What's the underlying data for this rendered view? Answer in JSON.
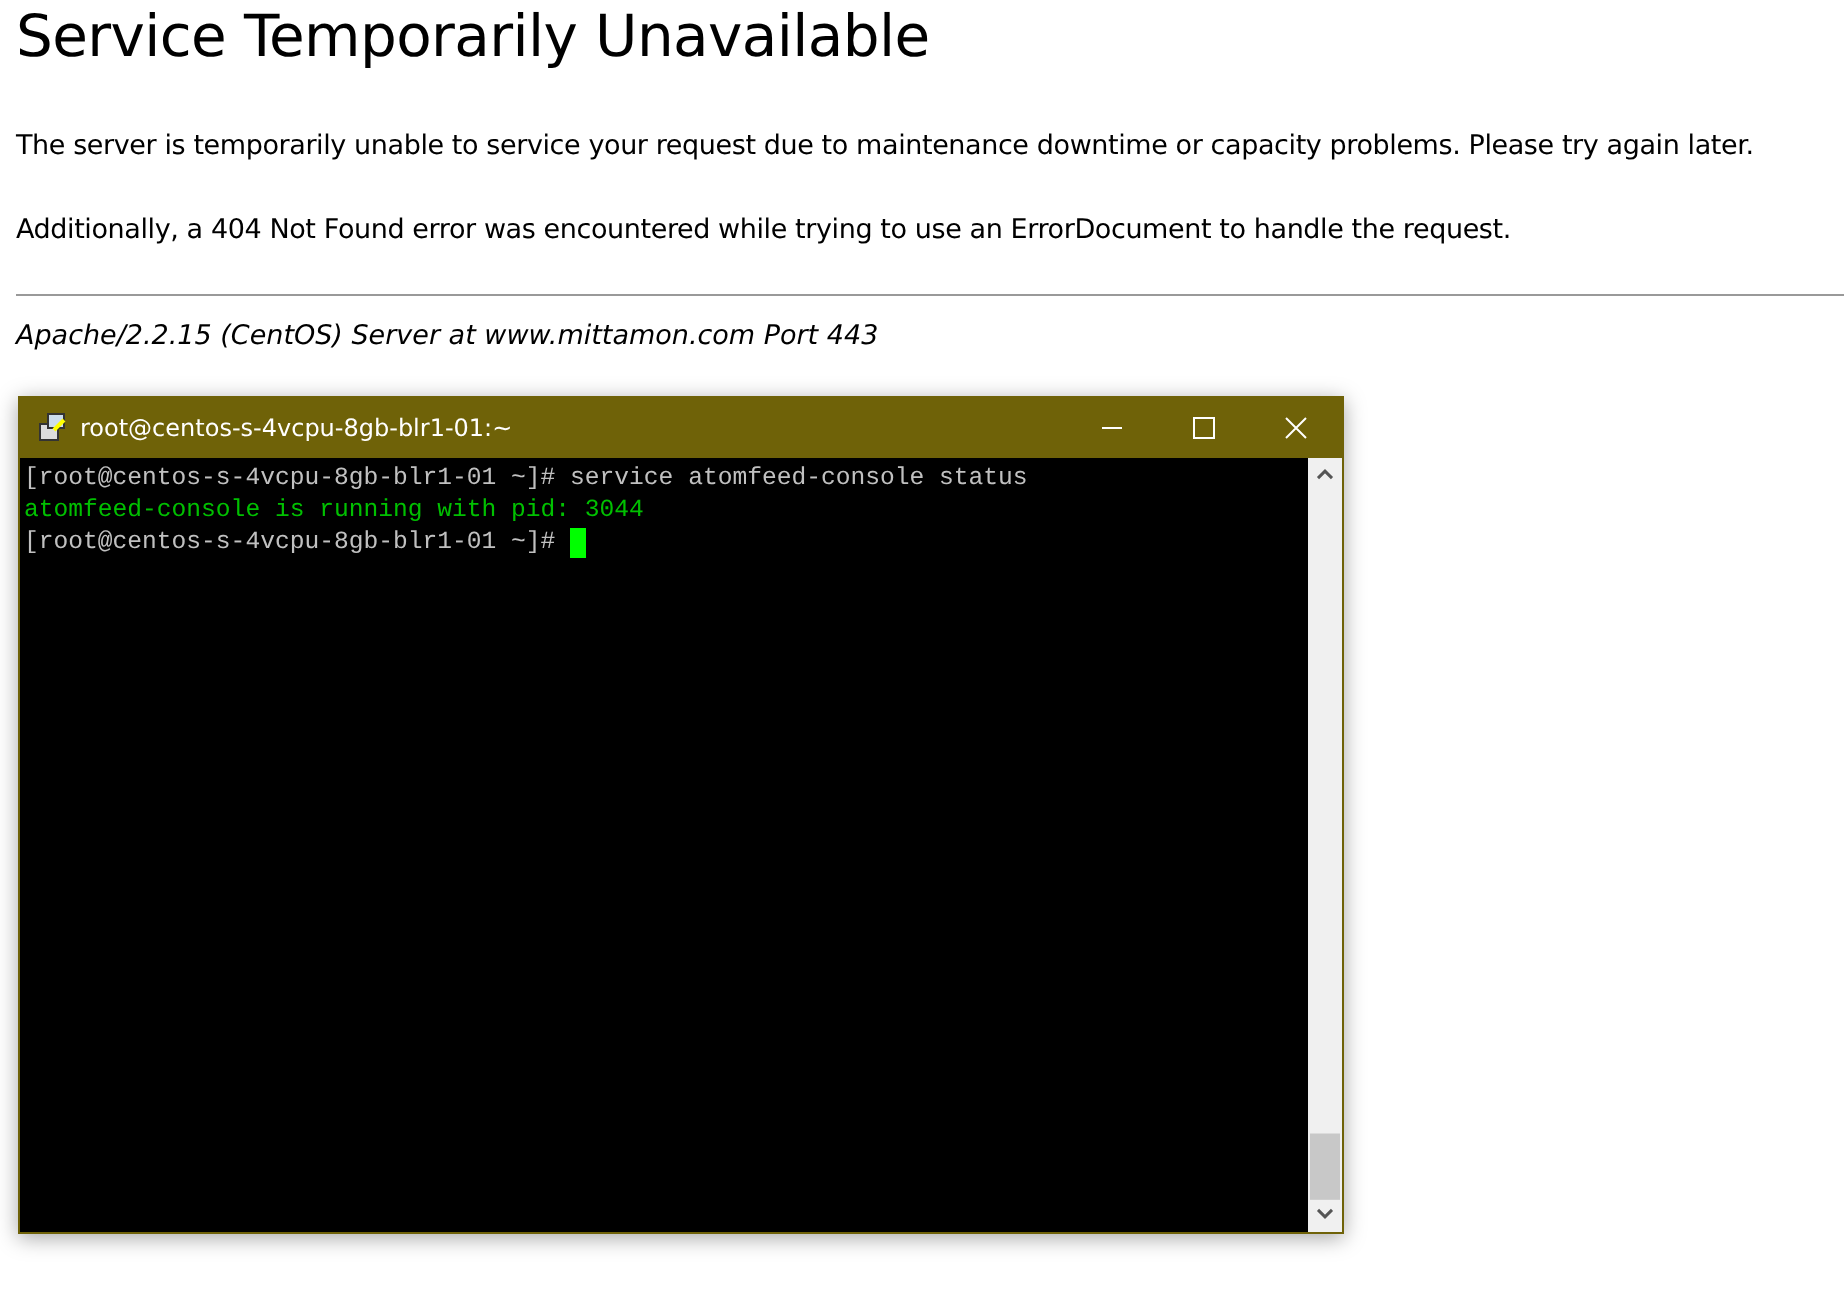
{
  "heading": "Service Temporarily Unavailable",
  "paragraphs": [
    "The server is temporarily unable to service your request due to maintenance downtime or capacity problems. Please try again later.",
    "Additionally, a 404 Not Found error was encountered while trying to use an ErrorDocument to handle the request."
  ],
  "address": "Apache/2.2.15 (CentOS) Server at www.mittamon.com Port 443",
  "terminal": {
    "title": "root@centos-s-4vcpu-8gb-blr1-01:~",
    "lines": [
      {
        "kind": "command",
        "text": "[root@centos-s-4vcpu-8gb-blr1-01 ~]# service atomfeed-console status"
      },
      {
        "kind": "output",
        "text": "atomfeed-console is running with pid: 3044"
      },
      {
        "kind": "prompt",
        "text": "[root@centos-s-4vcpu-8gb-blr1-01 ~]#"
      }
    ]
  }
}
